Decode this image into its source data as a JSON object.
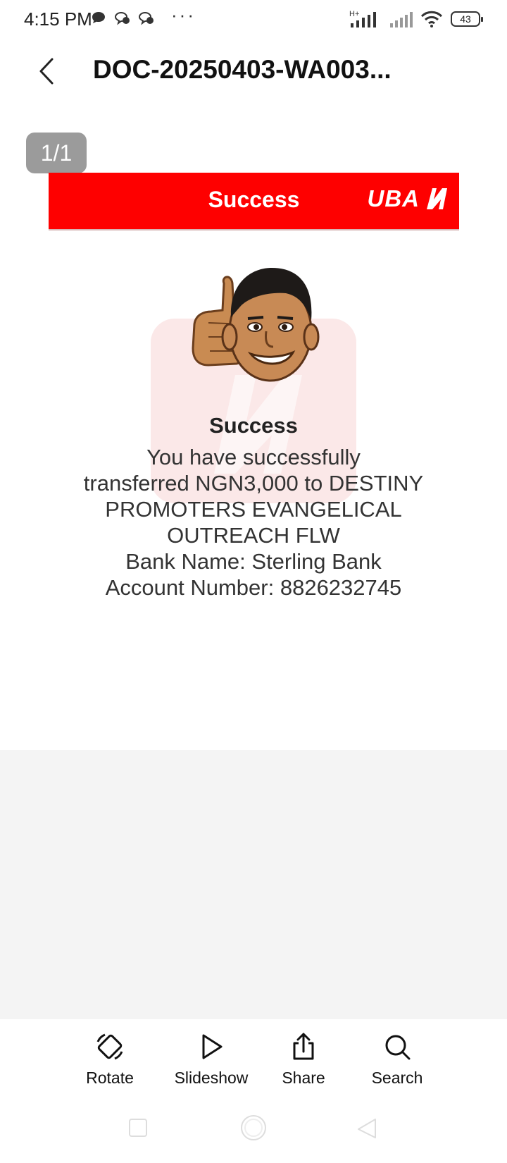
{
  "status_bar": {
    "time": "4:15 PM",
    "dots": "···",
    "network_label": "H+",
    "battery": "43"
  },
  "top_bar": {
    "title": "DOC-20250403-WA003..."
  },
  "viewer": {
    "page_indicator": "1/1",
    "receipt": {
      "header_title": "Success",
      "brand": "UBA",
      "heading": "Success",
      "message_lines": [
        "You have successfully",
        "transferred NGN3,000 to DESTINY",
        "PROMOTERS EVANGELICAL",
        "OUTREACH FLW",
        "Bank Name: Sterling Bank",
        "Account Number: 8826232745"
      ],
      "colors": {
        "header_red": "#fe0000"
      }
    }
  },
  "toolbar": {
    "rotate_label": "Rotate",
    "slideshow_label": "Slideshow",
    "share_label": "Share",
    "search_label": "Search"
  }
}
